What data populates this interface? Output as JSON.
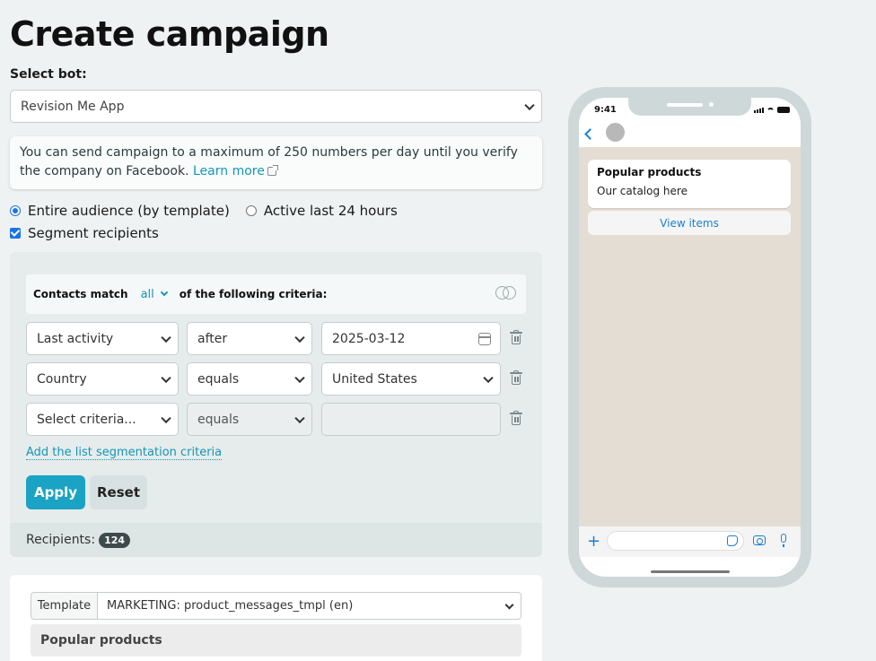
{
  "page": {
    "title": "Create campaign"
  },
  "bot": {
    "label": "Select bot:",
    "selected": "Revision Me App"
  },
  "notice": {
    "text": "You can send campaign to a maximum of 250 numbers per day until you verify the company on Facebook.",
    "link": "Learn more"
  },
  "audience": {
    "options": [
      {
        "label": "Entire audience (by template)",
        "selected": true
      },
      {
        "label": "Active last 24 hours",
        "selected": false
      }
    ],
    "segment_label": "Segment recipients",
    "segment_checked": true
  },
  "segmentation": {
    "match_prefix": "Contacts match",
    "match_value": "all",
    "match_suffix": "of the following criteria:",
    "rows": [
      {
        "field": "Last activity",
        "operator": "after",
        "value": "2025-03-12"
      },
      {
        "field": "Country",
        "operator": "equals",
        "value": "United States"
      },
      {
        "field": "Select criteria...",
        "operator": "equals",
        "value": ""
      }
    ],
    "add_link": "Add the list segmentation criteria",
    "apply_label": "Apply",
    "reset_label": "Reset",
    "recipients_label": "Recipients:",
    "recipients_count": "124"
  },
  "template": {
    "label": "Template",
    "selected": "MARKETING: product_messages_tmpl (en)",
    "header": "Popular products"
  },
  "preview": {
    "time": "9:41",
    "message_title": "Popular products",
    "message_body": "Our catalog here",
    "button_label": "View items"
  },
  "colors": {
    "accent": "#1aa3c4",
    "link": "#1596b6",
    "ios_blue": "#1a7fd4"
  }
}
